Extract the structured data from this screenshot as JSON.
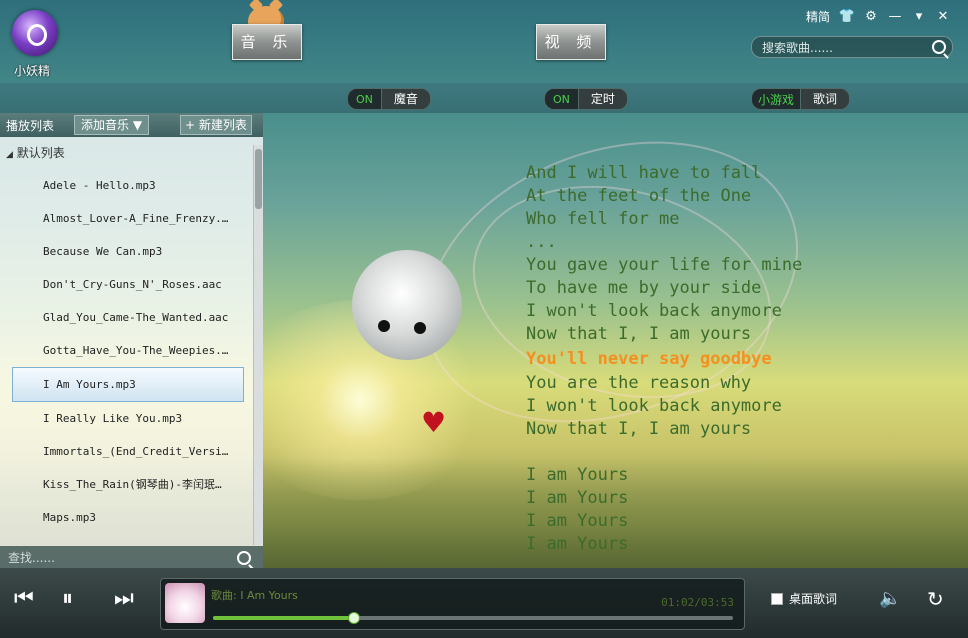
{
  "app": {
    "name": "小妖精"
  },
  "nav": {
    "music": "音 乐",
    "video": "视 频"
  },
  "top_right": {
    "skin_label": "精简"
  },
  "search": {
    "placeholder": "搜索歌曲......"
  },
  "toolbar": {
    "magic": {
      "state": "ON",
      "label": "魔音"
    },
    "timer": {
      "state": "ON",
      "label": "定时"
    },
    "game": {
      "label": "小游戏"
    },
    "lyrics": {
      "label": "歌词"
    }
  },
  "playlist": {
    "title": "播放列表",
    "add_music": "添加音乐",
    "new_list": "新建列表",
    "group": "默认列表",
    "items": [
      "Adele - Hello.mp3",
      "Almost_Lover-A_Fine_Frenzy.…",
      "Because We Can.mp3",
      "Don't_Cry-Guns_N'_Roses.aac",
      "Glad_You_Came-The_Wanted.aac",
      "Gotta_Have_You-The_Weepies.…",
      "I Am Yours.mp3",
      "I Really Like You.mp3",
      "Immortals_(End_Credit_Versi…",
      "Kiss_The_Rain(钢琴曲)-李闰珉…",
      "Maps.mp3"
    ],
    "active_index": 6,
    "find_placeholder": "查找......"
  },
  "lyrics": [
    "And I will have to fall",
    "At the feet of the One",
    "Who fell for me",
    "...",
    "You gave your life for mine",
    "To have me by your side",
    "I won't look back anymore",
    "Now that I, I am yours",
    "You'll never say goodbye",
    "You are the reason why",
    "I won't look back anymore",
    "Now that I, I am yours",
    "",
    "I am Yours",
    "I am Yours",
    "I am Yours",
    "I am Yours"
  ],
  "current_lyric_index": 8,
  "player": {
    "song_label": "歌曲: I Am Yours",
    "time": "01:02/03:53",
    "progress": 0.27,
    "desktop_lyrics": "桌面歌词"
  },
  "colors": {
    "lyric": "#3c6b2b",
    "lyric_current": "#f5901e",
    "toggle_on": "#4bcf4b"
  }
}
